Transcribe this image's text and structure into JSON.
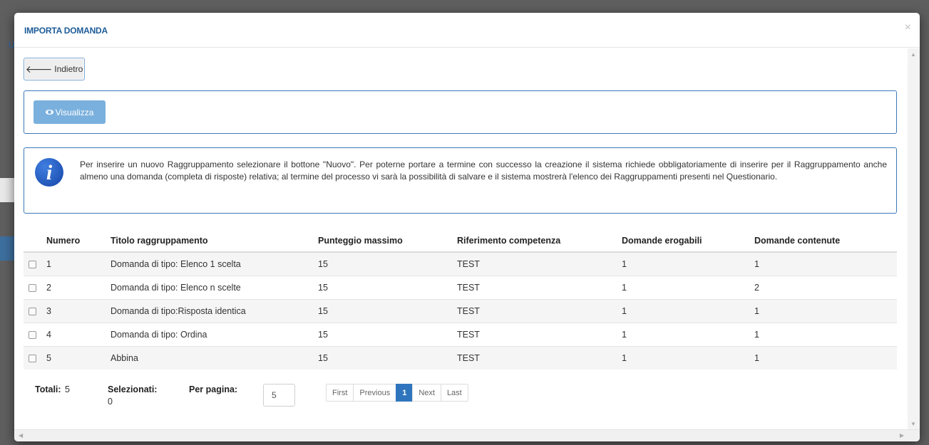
{
  "background": {
    "link_fragment": "U"
  },
  "modal": {
    "title": "IMPORTA DOMANDA",
    "close_symbol": "×"
  },
  "toolbar": {
    "back_icon": "arrow-left-icon",
    "back_label": "Indietro",
    "view_icon": "eye-icon",
    "view_label": "Visualizza"
  },
  "info": {
    "icon": "info-icon",
    "glyph": "i",
    "text": "Per inserire un nuovo Raggruppamento selezionare il bottone \"Nuovo\". Per poterne portare a termine con successo la creazione il sistema richiede obbligatoriamente di inserire per il Raggruppamento anche almeno una domanda (completa di risposte) relativa; al termine del processo vi sarà la possibilità di salvare e il sistema mostrerà l'elenco dei Raggruppamenti presenti nel Questionario."
  },
  "table": {
    "headers": {
      "numero": "Numero",
      "titolo": "Titolo raggruppamento",
      "punteggio": "Punteggio massimo",
      "riferimento": "Riferimento competenza",
      "erogabili": "Domande erogabili",
      "contenute": "Domande contenute"
    },
    "rows": [
      {
        "numero": "1",
        "titolo": "Domanda di tipo: Elenco 1 scelta",
        "punteggio": "15",
        "riferimento": "TEST",
        "erogabili": "1",
        "contenute": "1"
      },
      {
        "numero": "2",
        "titolo": "Domanda di tipo: Elenco n scelte",
        "punteggio": "15",
        "riferimento": "TEST",
        "erogabili": "1",
        "contenute": "2"
      },
      {
        "numero": "3",
        "titolo": "Domanda di tipo:Risposta identica",
        "punteggio": "15",
        "riferimento": "TEST",
        "erogabili": "1",
        "contenute": "1"
      },
      {
        "numero": "4",
        "titolo": "Domanda di tipo: Ordina",
        "punteggio": "15",
        "riferimento": "TEST",
        "erogabili": "1",
        "contenute": "1"
      },
      {
        "numero": "5",
        "titolo": "Abbina",
        "punteggio": "15",
        "riferimento": "TEST",
        "erogabili": "1",
        "contenute": "1"
      }
    ]
  },
  "footer": {
    "totali_label": "Totali:",
    "totali_value": "5",
    "selezionati_label": "Selezionati:",
    "selezionati_value": "0",
    "perpagina_label": "Per pagina:",
    "perpagina_value": "5"
  },
  "pager": {
    "first": "First",
    "previous": "Previous",
    "current": "1",
    "next": "Next",
    "last": "Last"
  },
  "colors": {
    "title": "#1d5c99",
    "panel_border": "#3a79b8",
    "view_button": "#7ab0dd",
    "pager_active": "#2f75bd"
  }
}
